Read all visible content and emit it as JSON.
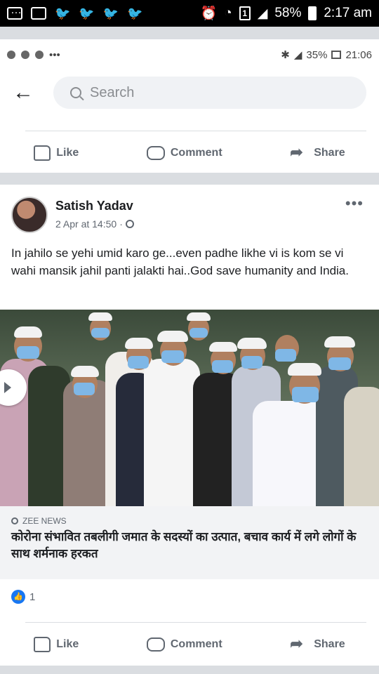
{
  "phone_status": {
    "battery": "58%",
    "time": "2:17 am",
    "sim": "1"
  },
  "inner_status": {
    "battery": "35%",
    "time": "21:06"
  },
  "search": {
    "placeholder": "Search"
  },
  "top_actions": {
    "like": "Like",
    "comment": "Comment",
    "share": "Share"
  },
  "post": {
    "author": "Satish Yadav",
    "date": "2 Apr at 14:50",
    "separator": "·",
    "more": "•••",
    "text": "In jahilo se yehi umid karo ge...even padhe likhe vi is kom se vi wahi mansik jahil panti jalakti hai..God save humanity and India.",
    "link": {
      "source": "ZEE NEWS",
      "headline": "कोरोना संभावित तबलीगी जमात के सदस्यों का उत्पात, बचाव कार्य में लगे लोगों के साथ शर्मनाक हरकत"
    },
    "reaction_count": "1",
    "actions": {
      "like": "Like",
      "comment": "Comment",
      "share": "Share"
    }
  },
  "colors": {
    "accent": "#1877f2",
    "muted": "#606770"
  }
}
